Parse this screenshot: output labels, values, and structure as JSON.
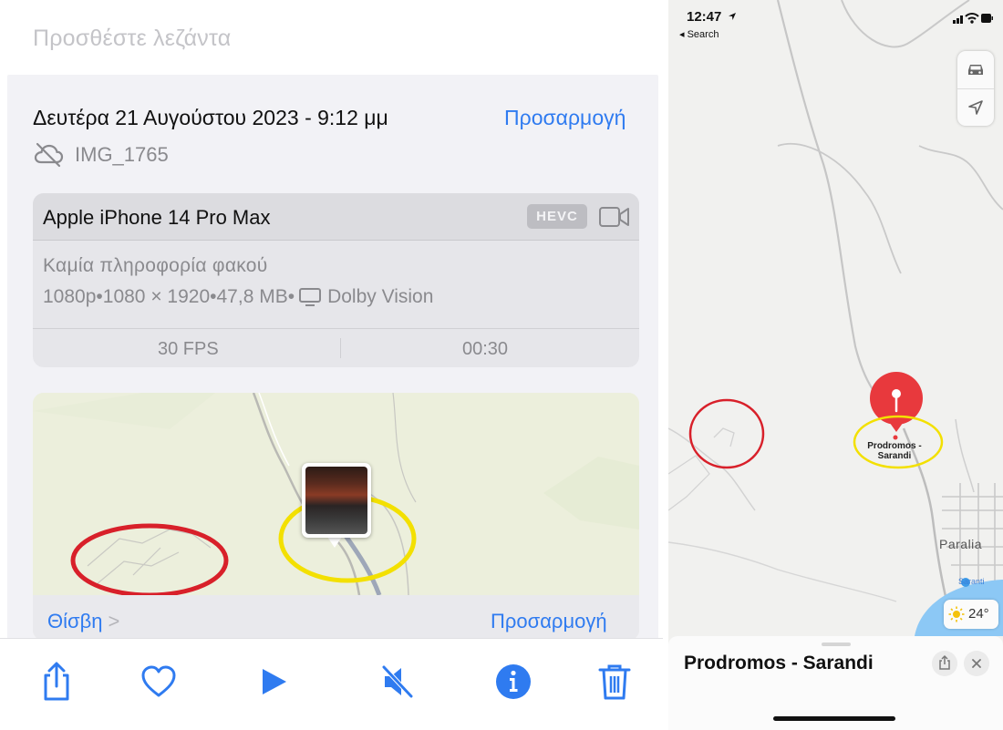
{
  "photos": {
    "caption_placeholder": "Προσθέστε λεζάντα",
    "date": "Δευτέρα 21 Αυγούστου 2023 - 9:12 μμ",
    "adjust_label": "Προσαρμογή",
    "file_name": "IMG_1765",
    "icons": {
      "cloud": "cloud-off-icon",
      "video": "video-camera-icon",
      "monitor": "display-icon"
    },
    "device": {
      "name": "Apple iPhone 14 Pro Max",
      "codec_badge": "HEVC",
      "lens": "Καμία πληροφορία φακού",
      "resolution": "1080p",
      "dimensions": "1080 × 1920",
      "file_size": "47,8 MB",
      "hdr": "Dolby Vision",
      "separator": " • ",
      "fps": "30 FPS",
      "duration": "00:30"
    },
    "map": {
      "location": "Θίσβη",
      "chevron": ">",
      "adjust_label": "Προσαρμογή",
      "annotation_colors": {
        "red_circle": "#d8202a",
        "yellow_circle": "#f3e000"
      }
    },
    "toolbar": [
      "share-icon",
      "favorite-heart-icon",
      "play-icon",
      "mute-icon",
      "info-icon",
      "trash-icon"
    ],
    "accent": "#2f7bf0"
  },
  "maps": {
    "status_time": "12:47",
    "back_label": "◂ Search",
    "place_label_line1": "Prodromos -",
    "place_label_line2": "Sarandi",
    "area_label": "Paralia",
    "poi_label": "Saranti",
    "weather": "24°",
    "sheet_title": "Prodromos - Sarandi",
    "pin_color": "#e8393d",
    "water_color": "#8cc8f5"
  }
}
